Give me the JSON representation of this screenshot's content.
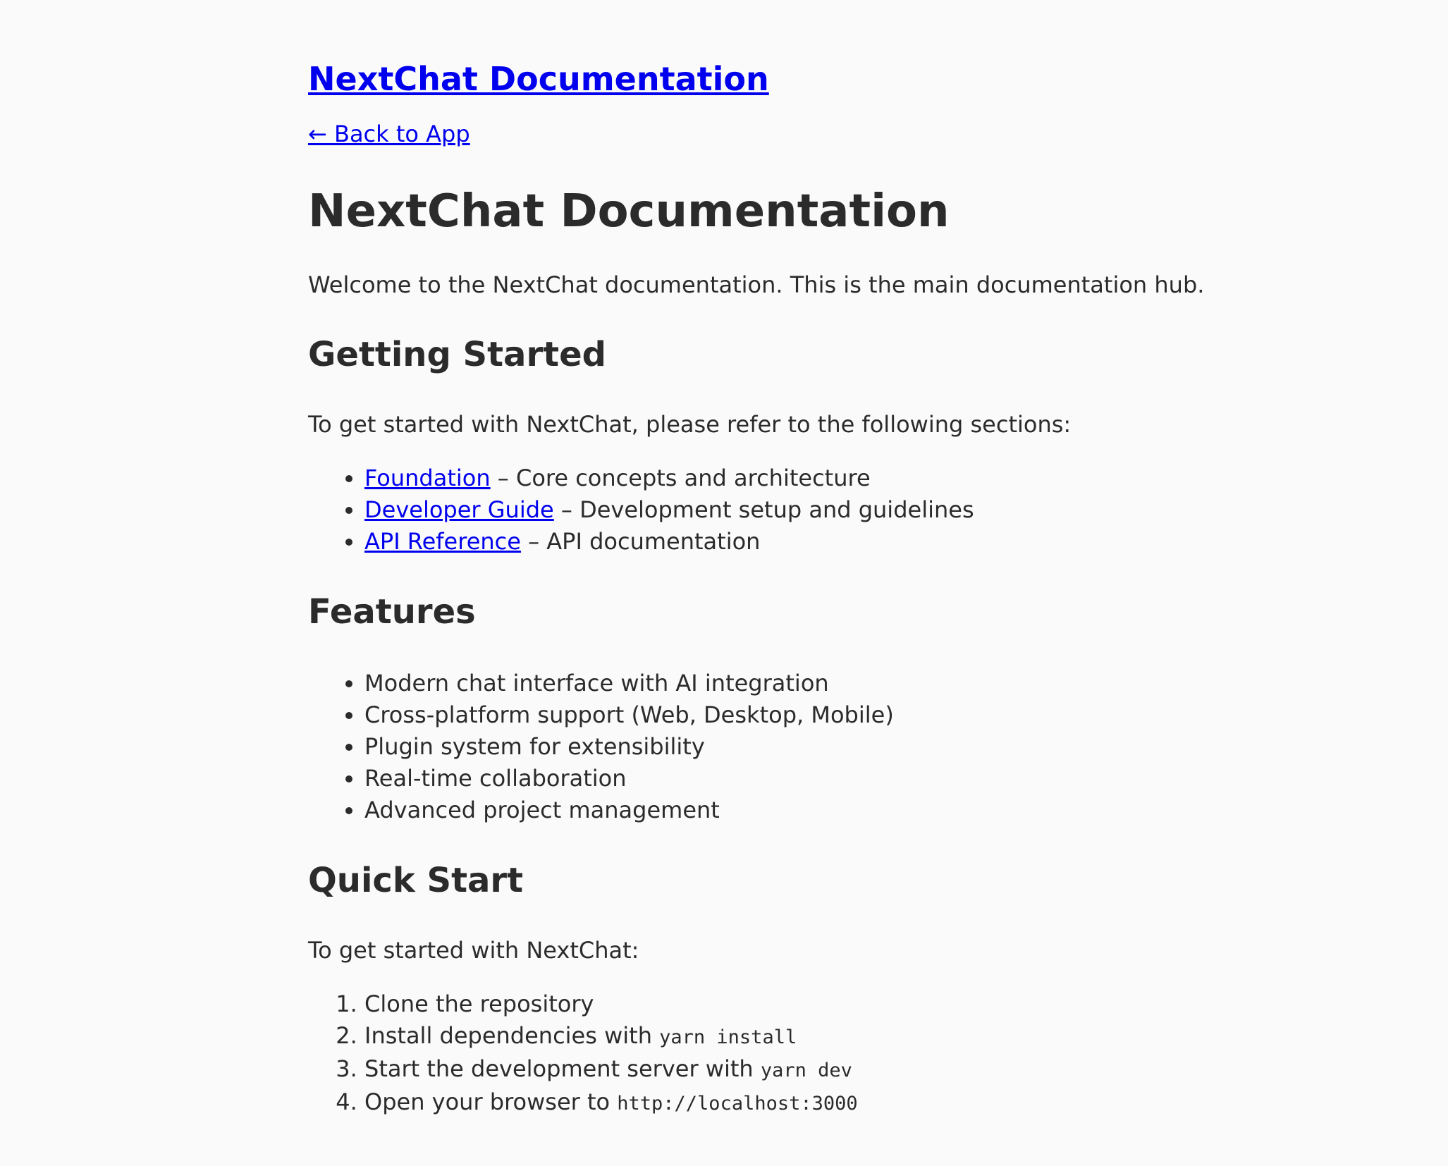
{
  "header": {
    "site_title": "NextChat Documentation",
    "back_link": "← Back to App"
  },
  "main": {
    "title": "NextChat Documentation",
    "intro": "Welcome to the NextChat documentation. This is the main documentation hub.",
    "getting_started": {
      "heading": "Getting Started",
      "text": "To get started with NextChat, please refer to the following sections:",
      "items": [
        {
          "link": "Foundation",
          "desc": " – Core concepts and architecture"
        },
        {
          "link": "Developer Guide",
          "desc": " – Development setup and guidelines"
        },
        {
          "link": "API Reference",
          "desc": " – API documentation"
        }
      ]
    },
    "features": {
      "heading": "Features",
      "items": [
        "Modern chat interface with AI integration",
        "Cross-platform support (Web, Desktop, Mobile)",
        "Plugin system for extensibility",
        "Real-time collaboration",
        "Advanced project management"
      ]
    },
    "quick_start": {
      "heading": "Quick Start",
      "text": "To get started with NextChat:",
      "steps": [
        {
          "text": "Clone the repository",
          "code": ""
        },
        {
          "text": "Install dependencies with ",
          "code": "yarn install"
        },
        {
          "text": "Start the development server with ",
          "code": "yarn dev"
        },
        {
          "text": "Open your browser to ",
          "code": "http://localhost:3000"
        }
      ]
    }
  },
  "colors": {
    "background": "#fafafa",
    "text": "#2b2b2b",
    "link": "#0000ee"
  }
}
